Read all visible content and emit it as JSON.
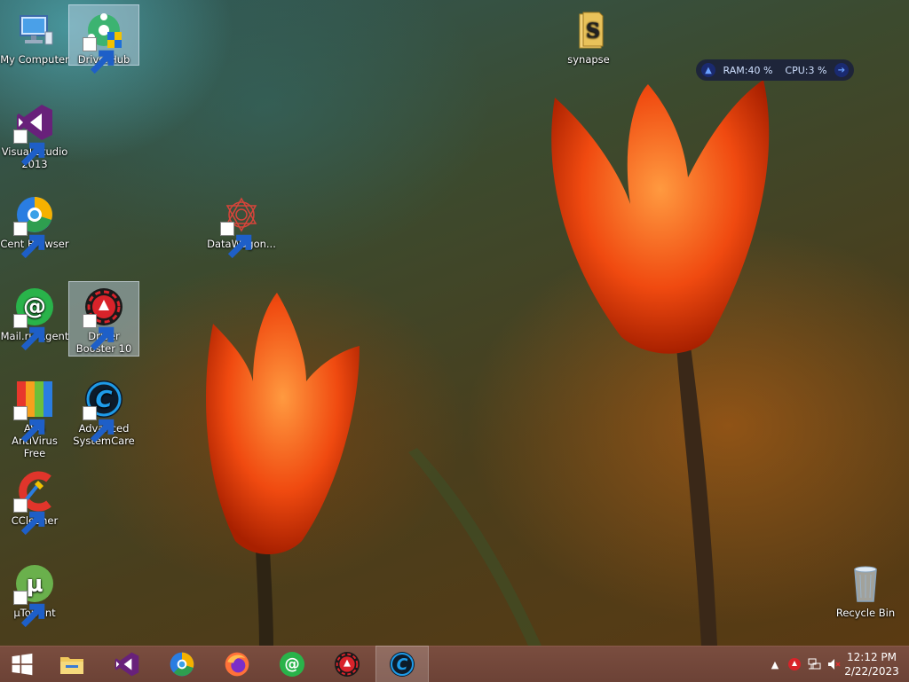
{
  "desktop_icons": [
    {
      "label": "My Computer"
    },
    {
      "label": "DriverHub"
    },
    {
      "label": "Visual Studio 2013"
    },
    {
      "label": "Cent Browser"
    },
    {
      "label": "DataWagon..."
    },
    {
      "label": "Mail.ru Agent"
    },
    {
      "label": "Driver Booster 10"
    },
    {
      "label": "AVG AntiVirus Free"
    },
    {
      "label": "Advanced SystemCare"
    },
    {
      "label": "CCleaner"
    },
    {
      "label": "µTorrent"
    },
    {
      "label": "synapse"
    },
    {
      "label": "Recycle Bin"
    }
  ],
  "widget": {
    "ram_label": "RAM:",
    "ram_value": "40 %",
    "cpu_label": "CPU:",
    "cpu_value": "3 %"
  },
  "taskbar": {
    "apps": [
      {
        "icon": "start-icon"
      },
      {
        "icon": "file-explorer-icon"
      },
      {
        "icon": "visual-studio-icon"
      },
      {
        "icon": "cent-browser-icon"
      },
      {
        "icon": "firefox-icon"
      },
      {
        "icon": "mail-ru-agent-icon"
      },
      {
        "icon": "driver-booster-icon"
      },
      {
        "icon": "advanced-systemcare-icon"
      }
    ]
  },
  "tray": {
    "time": "12:12 PM",
    "date": "2/22/2023"
  },
  "colors": {
    "taskbar": "#6c4236",
    "widget_bg": "#191e3c",
    "selection": "#c8dcf0"
  }
}
